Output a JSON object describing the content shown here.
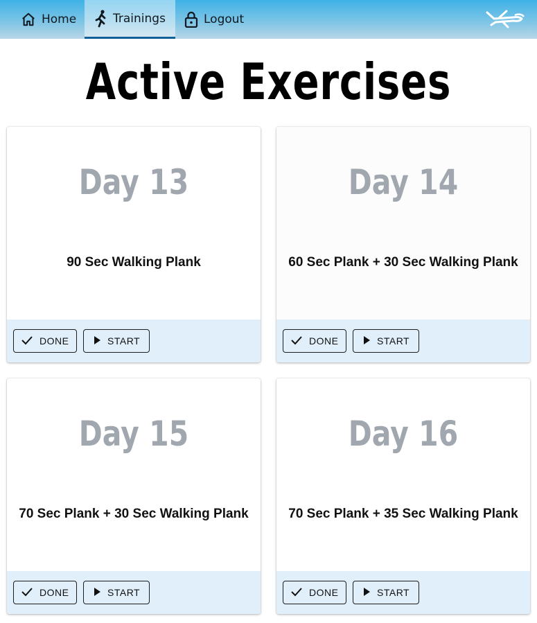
{
  "nav": {
    "items": [
      {
        "label": "Home",
        "icon": "home-icon"
      },
      {
        "label": "Trainings",
        "icon": "runner-icon",
        "active": true
      },
      {
        "label": "Logout",
        "icon": "lock-icon"
      }
    ],
    "logo_icon": "airplane-logo-icon",
    "accent_color": "#0d5f95"
  },
  "page": {
    "title": "Active Exercises"
  },
  "cards": [
    {
      "day": "Day 13",
      "exercise": "90 Sec Walking Plank",
      "done_label": "DONE",
      "start_label": "START"
    },
    {
      "day": "Day 14",
      "exercise": "60 Sec Plank + 30 Sec Walking Plank",
      "done_label": "DONE",
      "start_label": "START"
    },
    {
      "day": "Day 15",
      "exercise": "70 Sec Plank + 30 Sec Walking Plank",
      "done_label": "DONE",
      "start_label": "START"
    },
    {
      "day": "Day 16",
      "exercise": "70 Sec Plank + 35 Sec Walking Plank",
      "done_label": "DONE",
      "start_label": "START"
    }
  ]
}
